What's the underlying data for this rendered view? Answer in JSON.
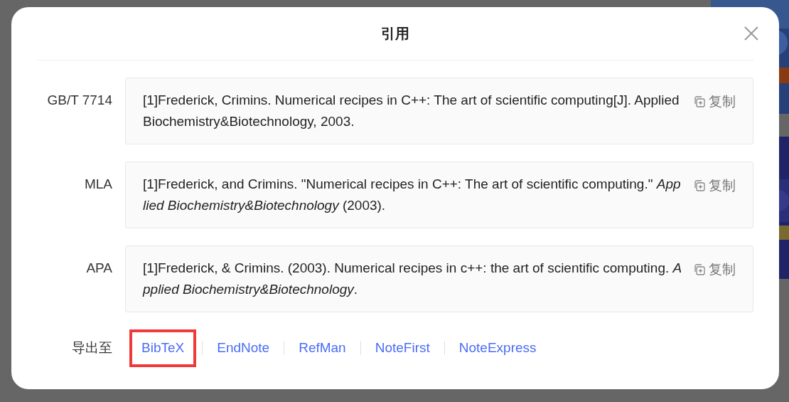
{
  "dialog": {
    "title": "引用",
    "citations": [
      {
        "style": "GB/T 7714",
        "text": "[1]Frederick, Crimins. Numerical recipes in C++: The art of scientific computing[J]. Applied Biochemistry&Biotechnology, 2003.",
        "copy": "复制"
      },
      {
        "style": "MLA",
        "text": "[1]Frederick, and Crimins. \"Numerical recipes in C++: The art of scientific computing.\" *Applied Biochemistry&Biotechnology* (2003).",
        "copy": "复制"
      },
      {
        "style": "APA",
        "text": "[1]Frederick, & Crimins. (2003). Numerical recipes in c++: the art of scientific computing. *Applied Biochemistry&Biotechnology*.",
        "copy": "复制"
      }
    ],
    "export": {
      "label": "导出至",
      "formats": [
        {
          "label": "BibTeX",
          "highlighted": true
        },
        {
          "label": "EndNote",
          "highlighted": false
        },
        {
          "label": "RefMan",
          "highlighted": false
        },
        {
          "label": "NoteFirst",
          "highlighted": false
        },
        {
          "label": "NoteExpress",
          "highlighted": false
        }
      ]
    }
  }
}
